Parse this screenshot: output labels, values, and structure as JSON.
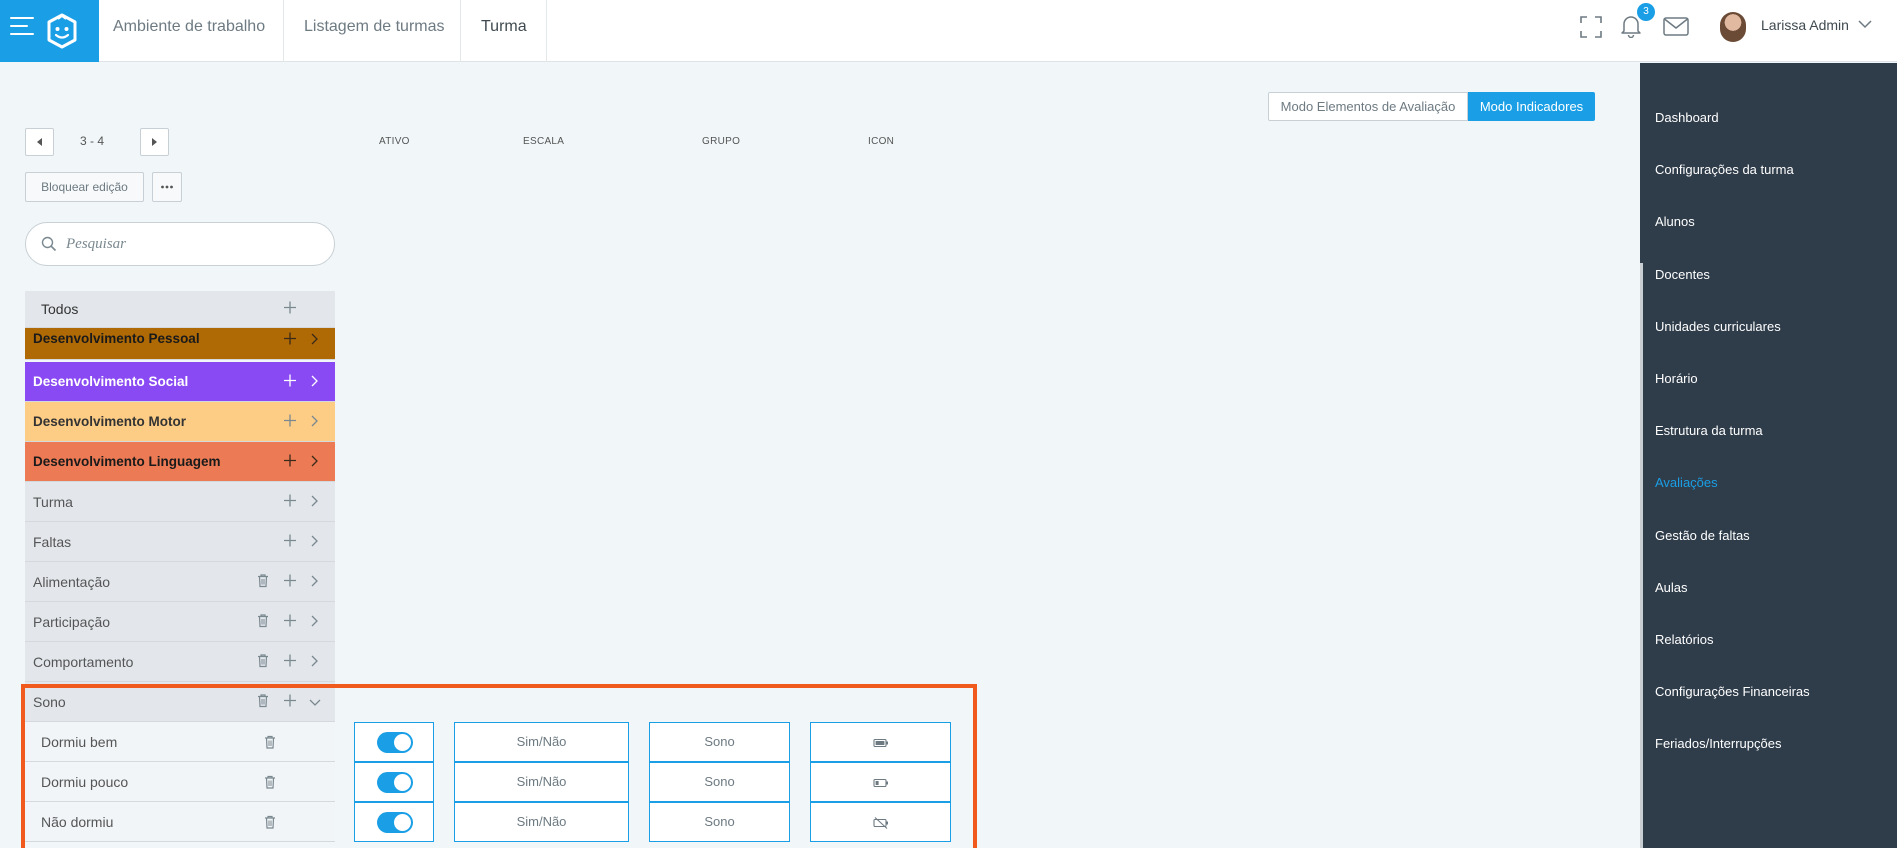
{
  "header": {
    "breadcrumbs": [
      "Ambiente de trabalho",
      "Listagem de turmas",
      "Turma"
    ],
    "notification_count": "3",
    "user_name": "Larissa Admin"
  },
  "sidebar": {
    "items": [
      {
        "label": "Dashboard",
        "active": false
      },
      {
        "label": "Configurações da turma",
        "active": false
      },
      {
        "label": "Alunos",
        "active": false
      },
      {
        "label": "Docentes",
        "active": false
      },
      {
        "label": "Unidades curriculares",
        "active": false
      },
      {
        "label": "Horário",
        "active": false
      },
      {
        "label": "Estrutura da turma",
        "active": false
      },
      {
        "label": "Avaliações",
        "active": true
      },
      {
        "label": "Gestão de faltas",
        "active": false
      },
      {
        "label": "Aulas",
        "active": false
      },
      {
        "label": "Relatórios",
        "active": false
      },
      {
        "label": "Configurações Financeiras",
        "active": false
      },
      {
        "label": "Feriados/Interrupções",
        "active": false
      }
    ]
  },
  "modes": {
    "elements_label": "Modo Elementos de Avaliação",
    "indicators_label": "Modo Indicadores",
    "active": "indicators"
  },
  "pager": {
    "range": "3 - 4"
  },
  "columns": {
    "active": "ATIVO",
    "scale": "ESCALA",
    "group": "GRUPO",
    "icon": "ICON"
  },
  "toolbar": {
    "lock_label": "Bloquear edição"
  },
  "search": {
    "placeholder": "Pesquisar"
  },
  "groups": [
    {
      "label": "Todos",
      "color": "#e3e7ec",
      "text": "#333333"
    },
    {
      "label": "Desenvolvimento Pessoal",
      "color": "#b06a05",
      "text": "#1a1a1a"
    },
    {
      "label": "Desenvolvimento Social",
      "color": "#8a4af3",
      "text": "#ffffff"
    },
    {
      "label": "Desenvolvimento Motor",
      "color": "#fdcd86",
      "text": "#333333"
    },
    {
      "label": "Desenvolvimento Linguagem",
      "color": "#ec7b55",
      "text": "#1a1a1a"
    },
    {
      "label": "Turma",
      "color": "#e3e7ec",
      "text": "#555555"
    },
    {
      "label": "Faltas",
      "color": "#e3e7ec",
      "text": "#555555"
    },
    {
      "label": "Alimentação",
      "color": "#e3e7ec",
      "text": "#555555"
    },
    {
      "label": "Participação",
      "color": "#e3e7ec",
      "text": "#555555"
    },
    {
      "label": "Comportamento",
      "color": "#e3e7ec",
      "text": "#555555"
    },
    {
      "label": "Sono",
      "color": "#e3e7ec",
      "text": "#555555"
    }
  ],
  "indicators": [
    {
      "label": "Dormiu bem",
      "active": true,
      "scale": "Sim/Não",
      "group": "Sono",
      "icon": "battery-full-icon"
    },
    {
      "label": "Dormiu pouco",
      "active": true,
      "scale": "Sim/Não",
      "group": "Sono",
      "icon": "battery-low-icon"
    },
    {
      "label": "Não dormiu",
      "active": true,
      "scale": "Sim/Não",
      "group": "Sono",
      "icon": "battery-slash-icon"
    }
  ]
}
